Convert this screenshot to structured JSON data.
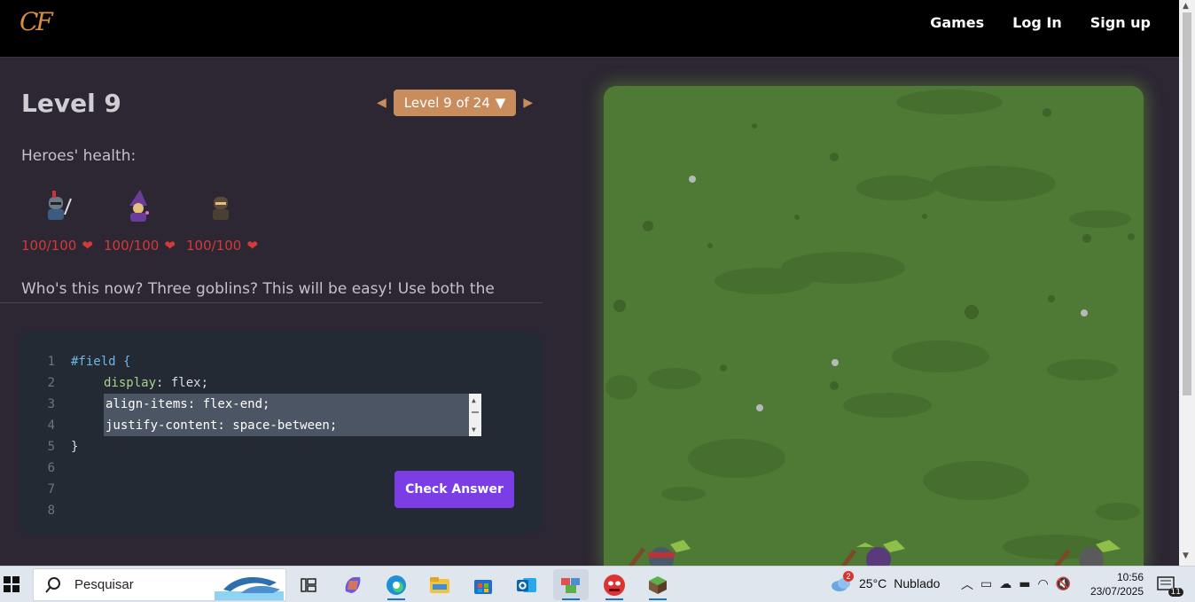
{
  "nav": {
    "logo": "CF",
    "links": [
      "Games",
      "Log In",
      "Sign up"
    ]
  },
  "level": {
    "title": "Level 9",
    "selector": "Level 9 of 24",
    "prev": "◀",
    "next": "▶",
    "dropdown_arrow": "▼"
  },
  "health": {
    "label": "Heroes' health:",
    "heroes": [
      {
        "name": "knight",
        "hp": "100/100"
      },
      {
        "name": "mage",
        "hp": "100/100"
      },
      {
        "name": "rogue",
        "hp": "100/100"
      }
    ]
  },
  "instructions": "Who's this now? Three goblins? This will be easy! Use both the",
  "editor": {
    "line_numbers": [
      "1",
      "2",
      "3",
      "4",
      "5",
      "6",
      "7",
      "8"
    ],
    "line1": "#field {",
    "line2_prop": "display",
    "line2_val": ": flex;",
    "input_lines": [
      "align-items: flex-end;",
      "justify-content: space-between;"
    ],
    "line5": "}",
    "check_button": "Check Answer"
  },
  "taskbar": {
    "search_placeholder": "Pesquisar",
    "weather_temp": "25°C",
    "weather_desc": "Nublado",
    "weather_badge": "2",
    "time": "10:56",
    "date": "23/07/2025",
    "notif_count": "11"
  },
  "colors": {
    "accent": "#c98d5d",
    "button": "#7b3de6",
    "field": "#4f7a35",
    "health": "#d13b3b"
  }
}
